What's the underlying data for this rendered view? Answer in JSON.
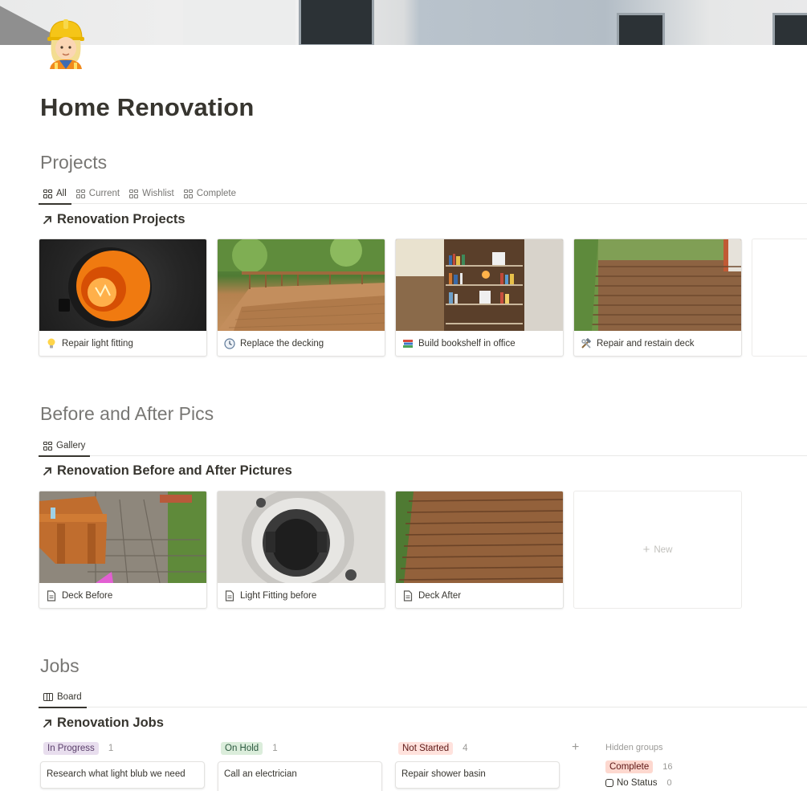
{
  "page": {
    "title": "Home Renovation",
    "icon": "construction-worker-icon"
  },
  "projects": {
    "heading": "Projects",
    "tabs": [
      {
        "label": "All",
        "active": true
      },
      {
        "label": "Current",
        "active": false
      },
      {
        "label": "Wishlist",
        "active": false
      },
      {
        "label": "Complete",
        "active": false
      }
    ],
    "db_title": "Renovation Projects",
    "cards": [
      {
        "title": "Repair light fitting",
        "icon": "lightbulb-icon"
      },
      {
        "title": "Replace the decking",
        "icon": "clock-icon"
      },
      {
        "title": "Build bookshelf in office",
        "icon": "books-icon"
      },
      {
        "title": "Repair and restain deck",
        "icon": "hammer-wrench-icon"
      }
    ]
  },
  "before_after": {
    "heading": "Before and After Pics",
    "tabs": [
      {
        "label": "Gallery",
        "active": true
      }
    ],
    "db_title": "Renovation Before and After Pictures",
    "cards": [
      {
        "title": "Deck Before",
        "icon": "page-icon"
      },
      {
        "title": "Light Fitting before",
        "icon": "page-icon"
      },
      {
        "title": "Deck After",
        "icon": "page-icon"
      }
    ],
    "new_label": "New"
  },
  "jobs": {
    "heading": "Jobs",
    "tabs": [
      {
        "label": "Board",
        "active": true
      }
    ],
    "db_title": "Renovation Jobs",
    "columns": [
      {
        "label": "In Progress",
        "count": "1",
        "bg": "#e8deee",
        "fg": "#5a3f6b",
        "cards": [
          "Research what light blub we need"
        ]
      },
      {
        "label": "On Hold",
        "count": "1",
        "bg": "#dbeddb",
        "fg": "#2b593f",
        "cards": [
          "Call an electrician"
        ]
      },
      {
        "label": "Not Started",
        "count": "4",
        "bg": "#ffe2dd",
        "fg": "#5d1715",
        "cards": [
          "Repair shower basin"
        ]
      }
    ],
    "hidden_groups": {
      "title": "Hidden groups",
      "items": [
        {
          "label": "Complete",
          "count": "16"
        },
        {
          "label": "No Status",
          "count": "0"
        }
      ]
    }
  }
}
